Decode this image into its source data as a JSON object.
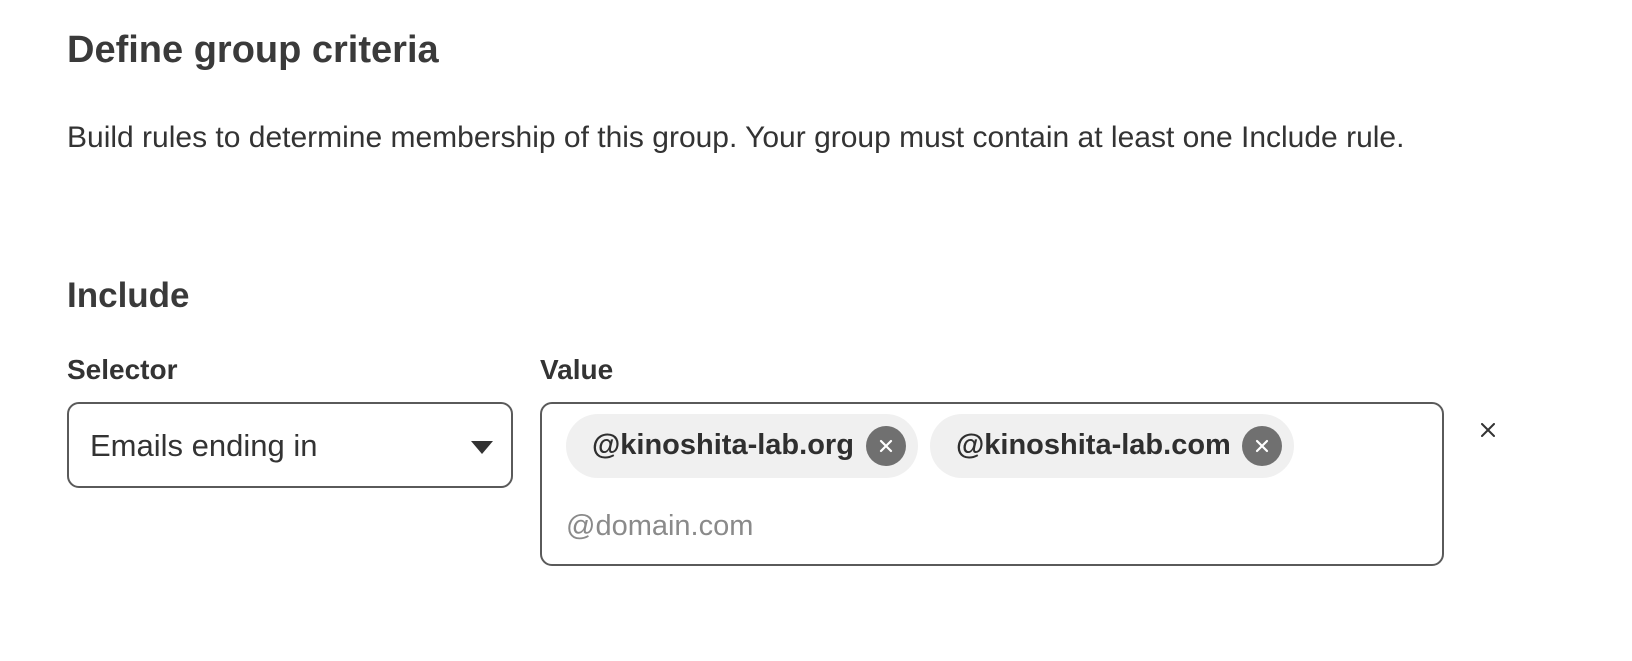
{
  "page": {
    "title": "Define group criteria",
    "description": "Build rules to determine membership of this group. Your group must contain at least one Include rule."
  },
  "include_section": {
    "heading": "Include",
    "selector": {
      "label": "Selector",
      "value": "Emails ending in",
      "icon": "chevron-down-icon"
    },
    "value_field": {
      "label": "Value",
      "chips": [
        {
          "label": "@kinoshita-lab.org",
          "remove_icon": "close-icon"
        },
        {
          "label": "@kinoshita-lab.com",
          "remove_icon": "close-icon"
        }
      ],
      "input_value": "",
      "placeholder": "@domain.com"
    },
    "remove_rule_icon": "close-icon"
  },
  "colors": {
    "text": "#333333",
    "border": "#5a5a5a",
    "chip_background": "#f0f0f0",
    "chip_remove_background": "#707070",
    "placeholder": "#8a8a8a"
  }
}
